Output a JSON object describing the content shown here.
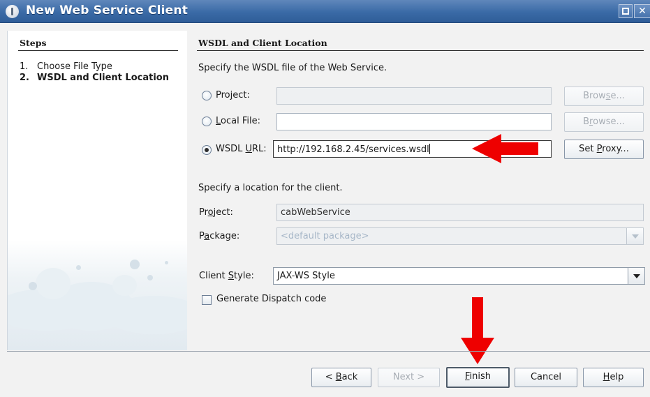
{
  "window": {
    "title": "New Web Service Client"
  },
  "steps": {
    "title": "Steps",
    "items": [
      {
        "num": "1.",
        "label": "Choose File Type"
      },
      {
        "num": "2.",
        "label": "WSDL and Client Location"
      }
    ]
  },
  "content": {
    "title": "WSDL and Client Location",
    "wsdl_instruction": "Specify the WSDL file of the Web Service.",
    "options": [
      {
        "label_before": "Pro",
        "mnemonic": "j",
        "label_after": "ect:",
        "value": "",
        "button_before": "Brow",
        "button_mnemonic": "s",
        "button_after": "e...",
        "button_enabled": false,
        "selected": false
      },
      {
        "label_before": "",
        "mnemonic": "L",
        "label_after": "ocal File:",
        "value": "",
        "button_before": "B",
        "button_mnemonic": "r",
        "button_after": "owse...",
        "button_enabled": false,
        "selected": false
      },
      {
        "label_before": "WSDL ",
        "mnemonic": "U",
        "label_after": "RL:",
        "value": "http://192.168.2.45/services.wsdl",
        "button_before": "Set ",
        "button_mnemonic": "P",
        "button_after": "roxy...",
        "button_enabled": true,
        "selected": true
      }
    ],
    "client_instruction": "Specify a location for the client.",
    "project": {
      "label_before": "Pr",
      "mnemonic": "o",
      "label_after": "ject:",
      "value": "cabWebService"
    },
    "package": {
      "label_before": "P",
      "mnemonic": "a",
      "label_after": "ckage:",
      "placeholder": "<default package>"
    },
    "client_style": {
      "label_before": "Client ",
      "mnemonic": "S",
      "label_after": "tyle:",
      "value": "JAX-WS Style"
    },
    "dispatch": {
      "label": "Generate Dispatch code",
      "checked": false
    }
  },
  "buttons": {
    "back": {
      "before": "< ",
      "mnemonic": "B",
      "after": "ack"
    },
    "next": {
      "label": "Next >"
    },
    "finish": {
      "before": "",
      "mnemonic": "F",
      "after": "inish"
    },
    "cancel": {
      "label": "Cancel"
    },
    "help": {
      "before": "",
      "mnemonic": "H",
      "after": "elp"
    }
  },
  "colors": {
    "titlebar": "#3a6aa6",
    "annotation_arrow": "#ee0000"
  }
}
